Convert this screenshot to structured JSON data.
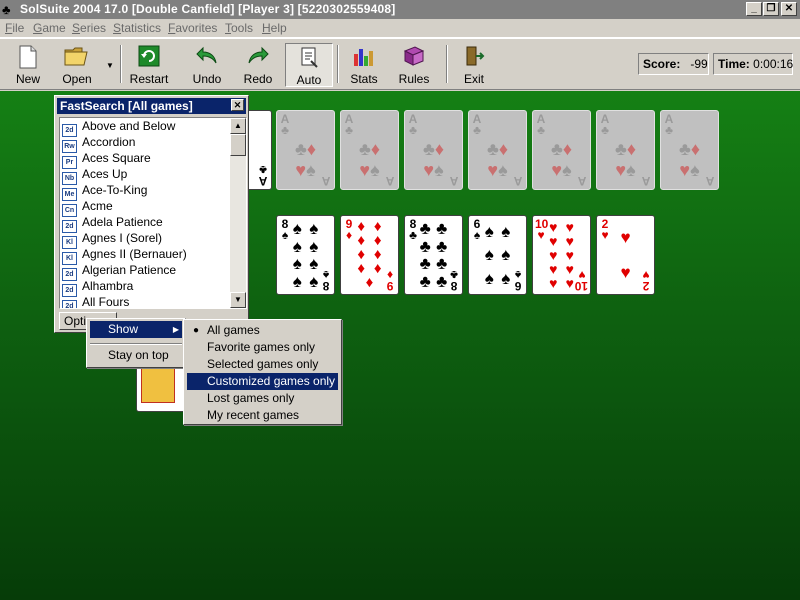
{
  "window": {
    "title": "SolSuite 2004 17.0  [Double Canfield]  [Player 3]  [5220302559408]",
    "app_icon": "card-suits-icon",
    "minimize": "_",
    "maximize": "❐",
    "close": "✕"
  },
  "menu": [
    "File",
    "Game",
    "Series",
    "Statistics",
    "Favorites",
    "Tools",
    "Help"
  ],
  "toolbar": {
    "new": "New",
    "open": "Open",
    "restart": "Restart",
    "undo": "Undo",
    "redo": "Redo",
    "auto": "Auto",
    "stats": "Stats",
    "rules": "Rules",
    "exit": "Exit",
    "score_label": "Score:",
    "score_value": "-99",
    "time_label": "Time:",
    "time_value": "0:00:16"
  },
  "foundations": [
    {
      "rank": "A",
      "suit": "♣"
    },
    {
      "rank": "A",
      "suit": "♣"
    },
    {
      "rank": "A",
      "suit": "♣"
    },
    {
      "rank": "A",
      "suit": "♣"
    },
    {
      "rank": "A",
      "suit": "♣"
    },
    {
      "rank": "A",
      "suit": "♣"
    },
    {
      "rank": "A",
      "suit": "♣"
    }
  ],
  "partial_card": {
    "rank": "A",
    "suit": "♣"
  },
  "tableau": [
    {
      "rank": "8",
      "suit": "♠",
      "color": "black"
    },
    {
      "rank": "9",
      "suit": "♦",
      "color": "red"
    },
    {
      "rank": "8",
      "suit": "♣",
      "color": "black"
    },
    {
      "rank": "6",
      "suit": "♠",
      "color": "black"
    },
    {
      "rank": "10",
      "suit": "♥",
      "color": "red"
    },
    {
      "rank": "2",
      "suit": "♥",
      "color": "red"
    }
  ],
  "fastsearch": {
    "title": "FastSearch [All games]",
    "close": "✕",
    "items": [
      {
        "badge": "2d",
        "name": "Above and Below"
      },
      {
        "badge": "Rw",
        "name": "Accordion"
      },
      {
        "badge": "Pr",
        "name": "Aces Square"
      },
      {
        "badge": "Nb",
        "name": "Aces Up"
      },
      {
        "badge": "Me",
        "name": "Ace-To-King"
      },
      {
        "badge": "Cn",
        "name": "Acme"
      },
      {
        "badge": "2d",
        "name": "Adela Patience"
      },
      {
        "badge": "Kl",
        "name": "Agnes I (Sorel)"
      },
      {
        "badge": "Kl",
        "name": "Agnes II (Bernauer)"
      },
      {
        "badge": "2d",
        "name": "Algerian Patience"
      },
      {
        "badge": "2d",
        "name": "Alhambra"
      },
      {
        "badge": "2d",
        "name": "All Fours"
      }
    ],
    "options_label": "Options"
  },
  "options_menu": {
    "show": "Show",
    "submenu_arrow": "▶",
    "stay_on_top": "Stay on top"
  },
  "show_menu": {
    "items": [
      "All games",
      "Favorite games only",
      "Selected games only",
      "Customized games only",
      "Lost games only",
      "My recent games"
    ],
    "checked_index": 0,
    "highlighted_index": 3
  },
  "colors": {
    "felt": "#0e6010",
    "selection": "#0a246a",
    "red_suit": "#e00000"
  }
}
